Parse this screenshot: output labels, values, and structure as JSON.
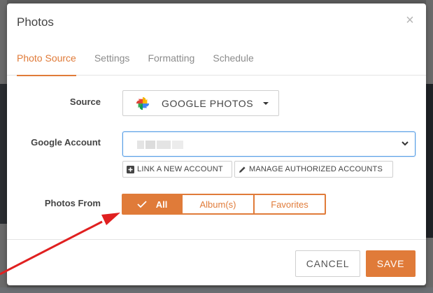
{
  "modal": {
    "title": "Photos",
    "close_glyph": "×"
  },
  "tabs": [
    {
      "label": "Photo Source",
      "active": true
    },
    {
      "label": "Settings",
      "active": false
    },
    {
      "label": "Formatting",
      "active": false
    },
    {
      "label": "Schedule",
      "active": false
    }
  ],
  "source": {
    "label": "Source",
    "value": "GOOGLE PHOTOS",
    "icon": "google-photos-icon"
  },
  "account": {
    "label": "Google Account",
    "value": "",
    "link_button": "LINK A NEW ACCOUNT",
    "manage_button": "MANAGE AUTHORIZED ACCOUNTS"
  },
  "photos_from": {
    "label": "Photos From",
    "options": [
      {
        "label": "All",
        "active": true
      },
      {
        "label": "Album(s)",
        "active": false
      },
      {
        "label": "Favorites",
        "active": false
      }
    ]
  },
  "footer": {
    "cancel_label": "CANCEL",
    "save_label": "SAVE"
  },
  "colors": {
    "accent": "#e07b39",
    "focus": "#5aa0e6",
    "annotation_arrow": "#e02020"
  }
}
